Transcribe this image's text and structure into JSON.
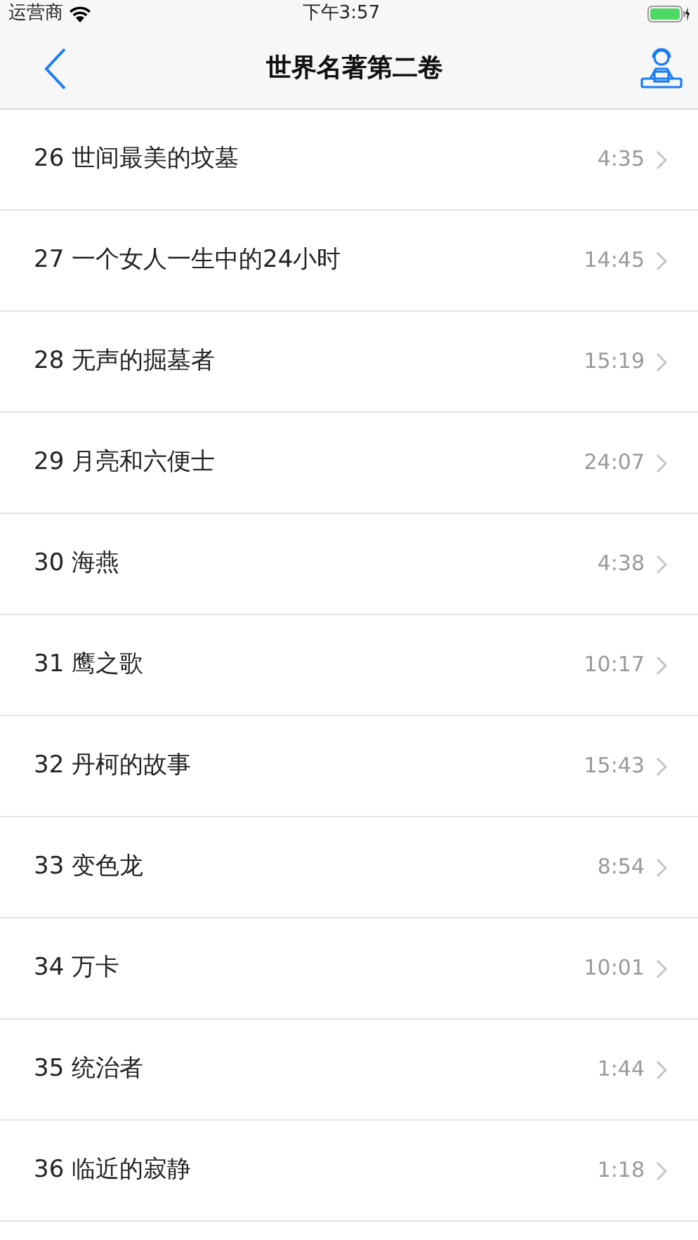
{
  "status_bar": {
    "carrier": "运营商",
    "time": "下午3:57"
  },
  "nav_bar": {
    "title": "世界名著第二卷"
  },
  "tracks": [
    {
      "title": "26 世间最美的坟墓",
      "duration": "4:35"
    },
    {
      "title": "27 一个女人一生中的24小时",
      "duration": "14:45"
    },
    {
      "title": "28 无声的掘墓者",
      "duration": "15:19"
    },
    {
      "title": "29 月亮和六便士",
      "duration": "24:07"
    },
    {
      "title": "30 海燕",
      "duration": "4:38"
    },
    {
      "title": "31 鹰之歌",
      "duration": "10:17"
    },
    {
      "title": "32 丹柯的故事",
      "duration": "15:43"
    },
    {
      "title": "33 变色龙",
      "duration": "8:54"
    },
    {
      "title": "34 万卡",
      "duration": "10:01"
    },
    {
      "title": "35 统治者",
      "duration": "1:44"
    },
    {
      "title": "36 临近的寂静",
      "duration": "1:18"
    }
  ]
}
